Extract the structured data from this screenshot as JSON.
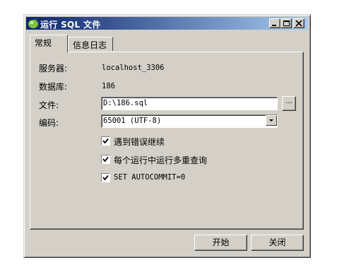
{
  "window": {
    "title": "运行 SQL 文件",
    "icon": "dolphin-icon"
  },
  "tabs": [
    {
      "label": "常规",
      "active": true
    },
    {
      "label": "信息日志",
      "active": false
    }
  ],
  "form": {
    "server_label": "服务器:",
    "server_value": "localhost_3306",
    "database_label": "数据库:",
    "database_value": "186",
    "file_label": "文件:",
    "file_value": "D:\\186.sql",
    "browse_label": "...",
    "encoding_label": "编码:",
    "encoding_value": "65001 (UTF-8)"
  },
  "options": [
    {
      "label": "遇到错误继续",
      "checked": true
    },
    {
      "label": "每个运行中运行多重查询",
      "checked": true
    },
    {
      "label": "SET AUTOCOMMIT=0",
      "checked": true
    }
  ],
  "buttons": {
    "start": "开始",
    "close": "关闭"
  }
}
